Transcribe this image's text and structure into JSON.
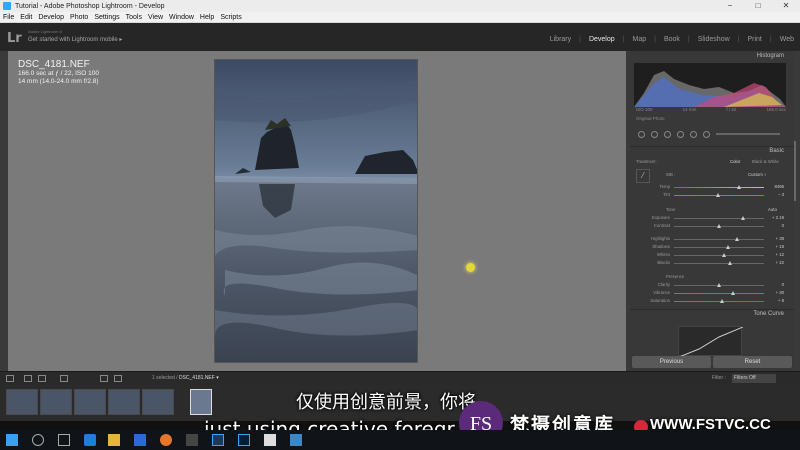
{
  "window": {
    "title": "Tutorial - Adobe Photoshop Lightroom - Develop",
    "min": "−",
    "max": "□",
    "close": "✕"
  },
  "menu": [
    "File",
    "Edit",
    "Develop",
    "Photo",
    "Settings",
    "Tools",
    "View",
    "Window",
    "Help",
    "Scripts"
  ],
  "lr": {
    "logo": "Lr",
    "product": "Adobe Lightroom 6",
    "mobile": "Get started with Lightroom mobile ▸"
  },
  "modules": [
    "Library",
    "Develop",
    "Map",
    "Book",
    "Slideshow",
    "Print",
    "Web"
  ],
  "active_module": "Develop",
  "photo_info": {
    "filename": "DSC_4181.NEF",
    "exposure": "166.0 sec at ƒ / 22, ISO 100",
    "lens": "14 mm (14.0-24.0 mm f/2.8)"
  },
  "right_panel": {
    "histogram_title": "Histogram",
    "histogram_values": [
      "ISO 100",
      "14 mm",
      "f / 22",
      "166.0 sec"
    ],
    "original_photo": "Original Photo",
    "basic_title": "Basic",
    "treatment_label": "Treatment :",
    "treatment_color": "Color",
    "treatment_bw": "Black & White",
    "wb_label": "WB :",
    "wb_value": "Custom ↕",
    "temp": {
      "label": "Temp",
      "value": "8496",
      "pos": 0.72
    },
    "tint": {
      "label": "Tint",
      "value": "− 3",
      "pos": 0.49
    },
    "tone_label": "Tone",
    "auto_label": "Auto",
    "exposure": {
      "label": "Exposure",
      "value": "+ 2.19",
      "pos": 0.77
    },
    "contrast": {
      "label": "Contrast",
      "value": "0",
      "pos": 0.5
    },
    "highlights": {
      "label": "Highlights",
      "value": "+ 38",
      "pos": 0.7
    },
    "shadows": {
      "label": "Shadows",
      "value": "+ 18",
      "pos": 0.6
    },
    "whites": {
      "label": "Whites",
      "value": "+ 12",
      "pos": 0.56
    },
    "blacks": {
      "label": "Blacks",
      "value": "+ 22",
      "pos": 0.62
    },
    "presence_label": "Presence",
    "clarity": {
      "label": "Clarity",
      "value": "0",
      "pos": 0.5
    },
    "vibrance": {
      "label": "Vibrance",
      "value": "+ 30",
      "pos": 0.65
    },
    "saturation": {
      "label": "Saturation",
      "value": "+ 8",
      "pos": 0.53
    },
    "tone_curve_title": "Tone Curve",
    "previous": "Previous",
    "reset": "Reset"
  },
  "toolbar": {
    "selected": "1 selected /",
    "filename": "DSC_4181.NEF ▾",
    "filter_label": "Filter :",
    "filter_value": "Filters Off"
  },
  "subtitles": {
    "cn": "仅使用创意前景，你将",
    "en": "just using creative foregr"
  },
  "watermark": {
    "logo": "FS",
    "cn": "梵摄创意库",
    "url": "WWW.FSTVC.CC"
  },
  "colors": {
    "accent_cursor": "#e2d83a",
    "watermark_red": "#d8263b",
    "panel": "#383838",
    "main_bg": "#7a7a7a"
  }
}
